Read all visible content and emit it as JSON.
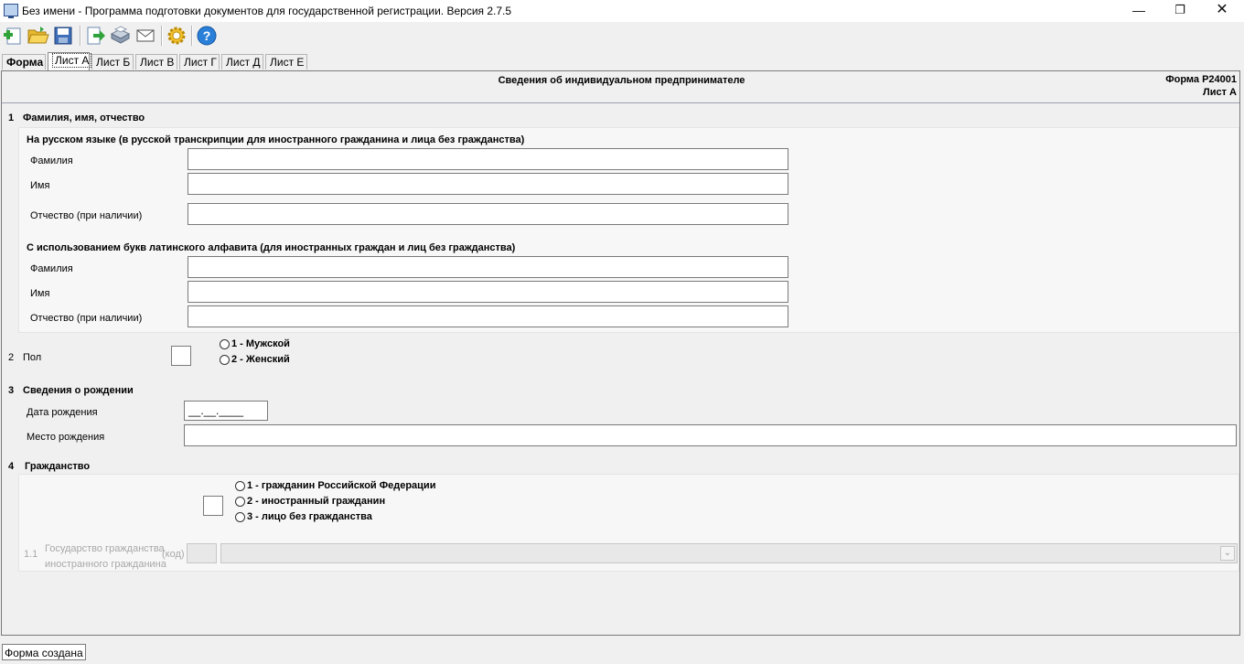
{
  "window": {
    "title": "Без имени - Программа подготовки документов для государственной регистрации. Версия 2.7.5",
    "minimize": "—",
    "maximize": "❐",
    "close": "✕"
  },
  "toolbar": {
    "buttons": [
      "new-document-icon",
      "open-folder-icon",
      "save-icon",
      "export-icon",
      "print-icon",
      "email-icon",
      "settings-gear-icon",
      "help-icon"
    ]
  },
  "tabs": [
    "Форма",
    "Лист А",
    "Лист Б",
    "Лист В",
    "Лист Г",
    "Лист Д",
    "Лист Е"
  ],
  "page": {
    "title": "Сведения об индивидуальном предпринимателе",
    "form_code": "Форма Р24001",
    "sheet": "Лист А"
  },
  "section1": {
    "num": "1",
    "title": "Фамилия, имя, отчество",
    "russian": {
      "heading": "На русском языке (в русской транскрипции для иностранного гражданина и лица без гражданства)",
      "surname": "Фамилия",
      "name": "Имя",
      "patronymic": "Отчество (при наличии)"
    },
    "latin": {
      "heading": "С использованием букв латинского алфавита (для иностранных граждан и лиц без гражданства)",
      "surname": "Фамилия",
      "name": "Имя",
      "patronymic": "Отчество (при наличии)"
    }
  },
  "section2": {
    "num": "2",
    "title": "Пол",
    "options": [
      "1 - Мужской",
      "2 - Женский"
    ]
  },
  "section3": {
    "num": "3",
    "title": "Сведения о рождении",
    "birth_date": "Дата рождения",
    "birth_date_mask": "__.__.____",
    "birth_place": "Место рождения"
  },
  "section4": {
    "num": "4",
    "title": "Гражданство",
    "options": [
      "1 - гражданин Российской Федерации",
      "2 - иностранный гражданин",
      "3 - лицо без гражданства"
    ],
    "sub_num": "1.1",
    "sub_label_line1": "Государство гражданства",
    "sub_label_line2": "иностранного гражданина",
    "code_label": "(код)"
  },
  "status": {
    "text": "Форма создана"
  }
}
